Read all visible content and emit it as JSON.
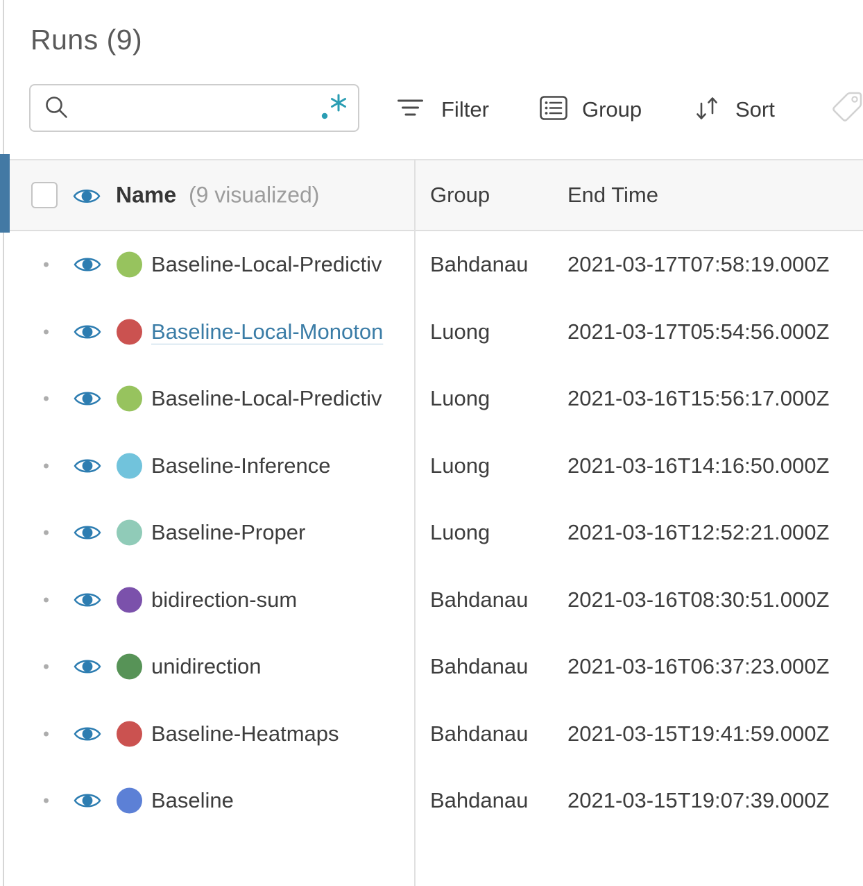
{
  "header": {
    "title": "Runs (9)"
  },
  "search": {
    "value": "",
    "placeholder": ""
  },
  "toolbar": {
    "filter_label": "Filter",
    "group_label": "Group",
    "sort_label": "Sort"
  },
  "table": {
    "columns": {
      "name": "Name",
      "name_suffix": "(9 visualized)",
      "group": "Group",
      "end_time": "End Time"
    },
    "rows": [
      {
        "name": "Baseline-Local-Predictiv",
        "dot_color": "#97c35e",
        "group": "Bahdanau",
        "end_time": "2021-03-17T07:58:19.000Z"
      },
      {
        "name": "Baseline-Local-Monoton",
        "dot_color": "#cb5250",
        "group": "Luong",
        "end_time": "2021-03-17T05:54:56.000Z"
      },
      {
        "name": "Baseline-Local-Predictiv",
        "dot_color": "#97c35e",
        "group": "Luong",
        "end_time": "2021-03-16T15:56:17.000Z"
      },
      {
        "name": "Baseline-Inference",
        "dot_color": "#71c3dc",
        "group": "Luong",
        "end_time": "2021-03-16T14:16:50.000Z"
      },
      {
        "name": "Baseline-Proper",
        "dot_color": "#90cbb8",
        "group": "Luong",
        "end_time": "2021-03-16T12:52:21.000Z"
      },
      {
        "name": "bidirection-sum",
        "dot_color": "#7b51ab",
        "group": "Bahdanau",
        "end_time": "2021-03-16T08:30:51.000Z"
      },
      {
        "name": "unidirection",
        "dot_color": "#579357",
        "group": "Bahdanau",
        "end_time": "2021-03-16T06:37:23.000Z"
      },
      {
        "name": "Baseline-Heatmaps",
        "dot_color": "#cb5250",
        "group": "Bahdanau",
        "end_time": "2021-03-15T19:41:59.000Z"
      },
      {
        "name": "Baseline",
        "dot_color": "#5c80d6",
        "group": "Bahdanau",
        "end_time": "2021-03-15T19:07:39.000Z"
      }
    ]
  },
  "colors": {
    "accent_blue_bar": "#4379a4",
    "eye_icon": "#2d7db1",
    "regex_teal": "#2a9db3",
    "link_text": "#3a7ca6",
    "header_bg": "#f7f7f7"
  }
}
